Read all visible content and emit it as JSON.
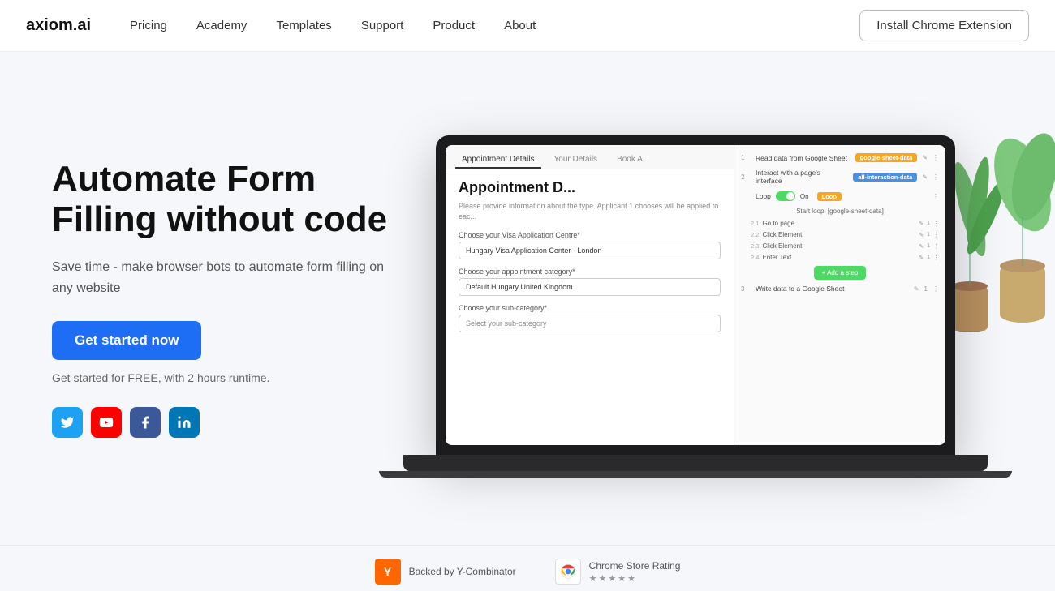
{
  "navbar": {
    "logo": "axiom.ai",
    "links": [
      {
        "label": "Pricing",
        "id": "pricing"
      },
      {
        "label": "Academy",
        "id": "academy"
      },
      {
        "label": "Templates",
        "id": "templates"
      },
      {
        "label": "Support",
        "id": "support"
      },
      {
        "label": "Product",
        "id": "product"
      },
      {
        "label": "About",
        "id": "about"
      }
    ],
    "cta_label": "Install Chrome Extension"
  },
  "hero": {
    "title": "Automate Form Filling without code",
    "subtitle": "Save time - make browser bots to automate form filling on any website",
    "cta_button": "Get started now",
    "free_text": "Get started for FREE, with 2 hours runtime.",
    "social": [
      {
        "id": "twitter",
        "label": "Twitter",
        "icon": "🐦"
      },
      {
        "id": "youtube",
        "label": "YouTube",
        "icon": "▶"
      },
      {
        "id": "facebook",
        "label": "Facebook",
        "icon": "f"
      },
      {
        "id": "linkedin",
        "label": "LinkedIn",
        "icon": "in"
      }
    ]
  },
  "laptop_screen": {
    "tabs": [
      "Appointment Details",
      "Your Details",
      "Book A..."
    ],
    "form_title": "Appointment D...",
    "form_desc": "Please provide information about the type. Applicant 1 chooses will be applied to eac...",
    "fields": [
      {
        "label": "Choose your Visa Application Centre*",
        "value": "Hungary Visa Application Center - London",
        "type": "input"
      },
      {
        "label": "Choose your appointment category*",
        "value": "Default Hungary United Kingdom",
        "type": "input"
      },
      {
        "label": "Choose your sub-category*",
        "value": "Select your sub-category",
        "type": "select"
      }
    ],
    "steps": [
      {
        "num": "1",
        "text": "Read data from Google Sheet",
        "tag": "google-sheet-data",
        "tag_color": "yellow"
      },
      {
        "num": "2",
        "text": "Interact with a page's interface",
        "tag": "all-interaction-data",
        "tag_color": "blue"
      },
      {
        "loop": true,
        "text": "Loop",
        "toggle": "On"
      },
      {
        "section": "Start loop: [google-sheet-data]"
      },
      {
        "sub": "2.1",
        "text": "Go to page"
      },
      {
        "sub": "2.2",
        "text": "Click Element"
      },
      {
        "sub": "2.3",
        "text": "Click Element"
      },
      {
        "sub": "2.4",
        "text": "Enter Text"
      },
      {
        "add_step": true
      },
      {
        "num": "3",
        "text": "Write data to a Google Sheet",
        "tag": null
      }
    ],
    "add_step_label": "+ Add a step"
  },
  "footer": {
    "badges": [
      {
        "icon_label": "Y",
        "icon_style": "ycomb",
        "title": "Backed by Y-Combinator",
        "sub": null
      },
      {
        "icon_label": "◎",
        "icon_style": "chrome",
        "title": "Chrome Store Rating",
        "stars": 5,
        "star_char": "★"
      }
    ]
  },
  "colors": {
    "accent_blue": "#1e6ef5",
    "tag_yellow": "#f5a623",
    "tag_blue": "#4a90e2",
    "tag_green": "#4cd964",
    "ycomb_orange": "#ff6600"
  }
}
